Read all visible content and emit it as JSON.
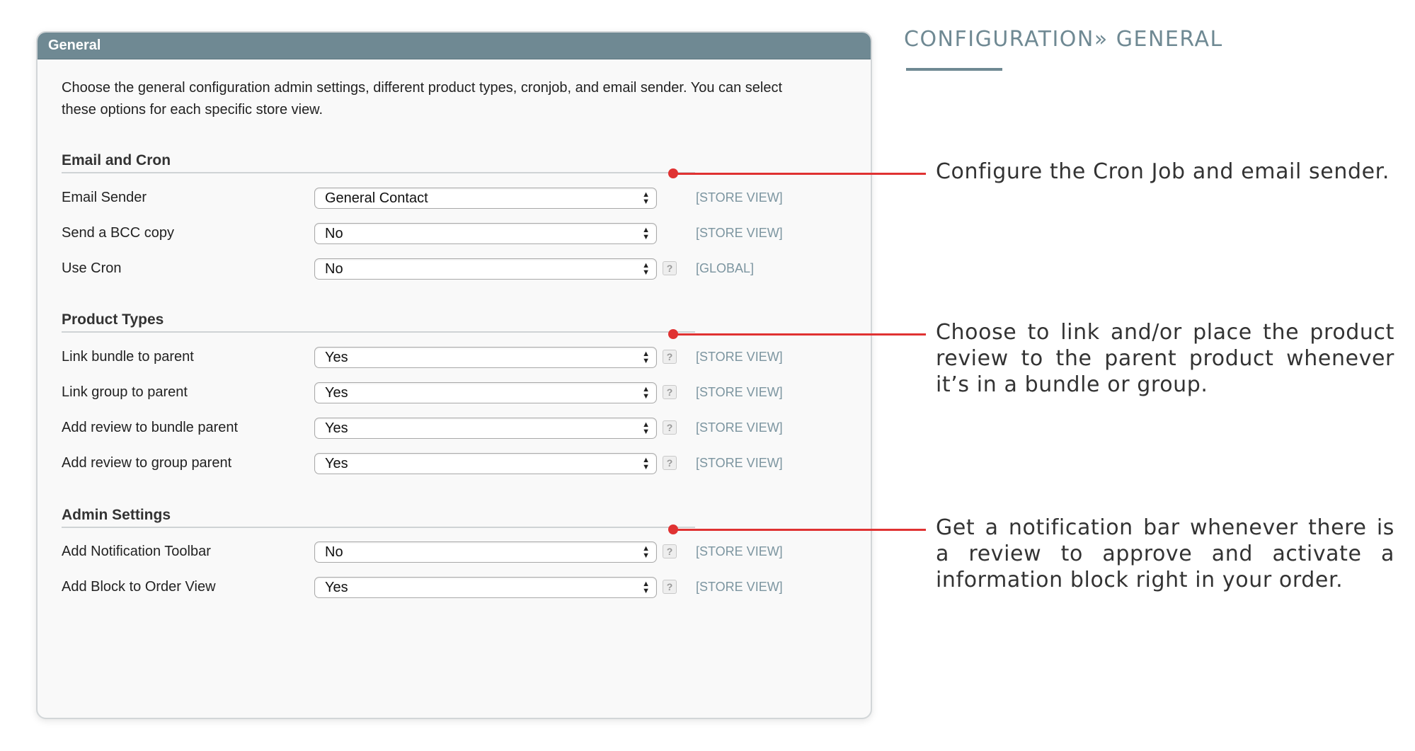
{
  "panel": {
    "title": "General",
    "intro": "Choose the general configuration admin settings, different product types, cronjob, and email sender. You can select these options for each specific store view."
  },
  "sections": [
    {
      "title": "Email and Cron",
      "rows": [
        {
          "label": "Email Sender",
          "value": "General Contact",
          "help": false,
          "scope": "[STORE VIEW]"
        },
        {
          "label": "Send a BCC copy",
          "value": "No",
          "help": false,
          "scope": "[STORE VIEW]"
        },
        {
          "label": "Use Cron",
          "value": "No",
          "help": true,
          "scope": "[GLOBAL]"
        }
      ]
    },
    {
      "title": "Product Types",
      "rows": [
        {
          "label": "Link bundle to parent",
          "value": "Yes",
          "help": true,
          "scope": "[STORE VIEW]"
        },
        {
          "label": "Link group to parent",
          "value": "Yes",
          "help": true,
          "scope": "[STORE VIEW]"
        },
        {
          "label": "Add review to bundle parent",
          "value": "Yes",
          "help": true,
          "scope": "[STORE VIEW]"
        },
        {
          "label": "Add review to group parent",
          "value": "Yes",
          "help": true,
          "scope": "[STORE VIEW]"
        }
      ]
    },
    {
      "title": "Admin Settings",
      "rows": [
        {
          "label": "Add Notification Toolbar",
          "value": "No",
          "help": true,
          "scope": "[STORE VIEW]"
        },
        {
          "label": "Add Block to Order View",
          "value": "Yes",
          "help": true,
          "scope": "[STORE VIEW]"
        }
      ]
    }
  ],
  "help_glyph": "?",
  "select_arrow_icon": "updown-arrows-icon",
  "heading": "CONFIGURATION» GENERAL",
  "callouts": [
    "Configure the Cron Job and email sender.",
    "Choose to link and/or place the product review to the parent product whenever it’s in a bundle or group.",
    "Get a notification bar whenever there is a review to approve and activate a information block right in your order."
  ],
  "colors": {
    "header": "#6f8993",
    "accent": "#e03232",
    "scope": "#7c95a0"
  }
}
